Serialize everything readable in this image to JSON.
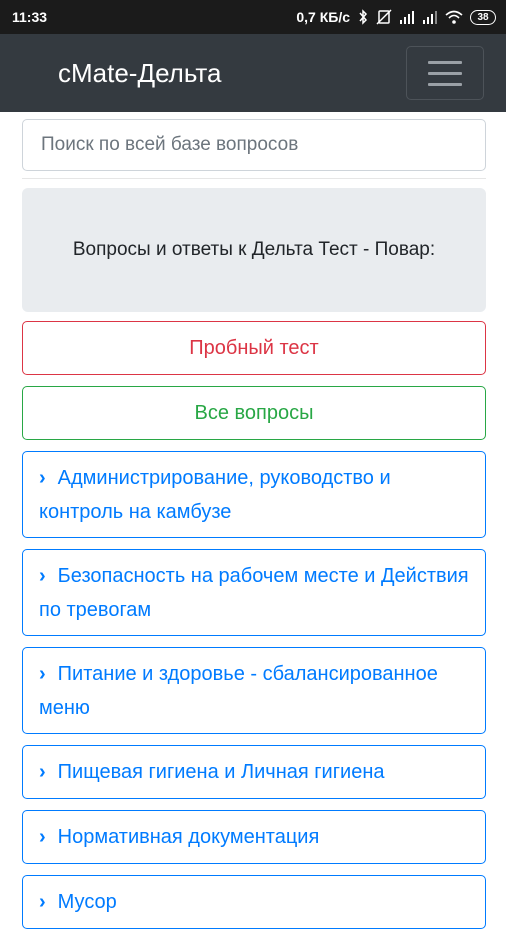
{
  "status_bar": {
    "time": "11:33",
    "net_speed": "0,7 КБ/с",
    "battery": "38"
  },
  "navbar": {
    "brand": "cMate-Дельта",
    "menu_icon": "hamburger-menu-icon"
  },
  "search": {
    "placeholder": "Поиск по всей базе вопросов",
    "value": ""
  },
  "intro": {
    "text": "Вопросы и ответы к Дельта Тест - Повар:"
  },
  "buttons": {
    "trial_test": "Пробный тест",
    "all_questions": "Все вопросы"
  },
  "categories": [
    {
      "label": "Администрирование, руководство и контроль на камбузе"
    },
    {
      "label": "Безопасность на рабочем месте и Действия по тревогам"
    },
    {
      "label": "Питание и здоровье - сбалансированное меню"
    },
    {
      "label": "Пищевая гигиена и Личная гигиена"
    },
    {
      "label": "Нормативная документация"
    },
    {
      "label": "Мусор"
    }
  ],
  "colors": {
    "navbar_bg": "#343a40",
    "danger": "#dc3545",
    "success": "#28a745",
    "primary": "#007bff"
  }
}
